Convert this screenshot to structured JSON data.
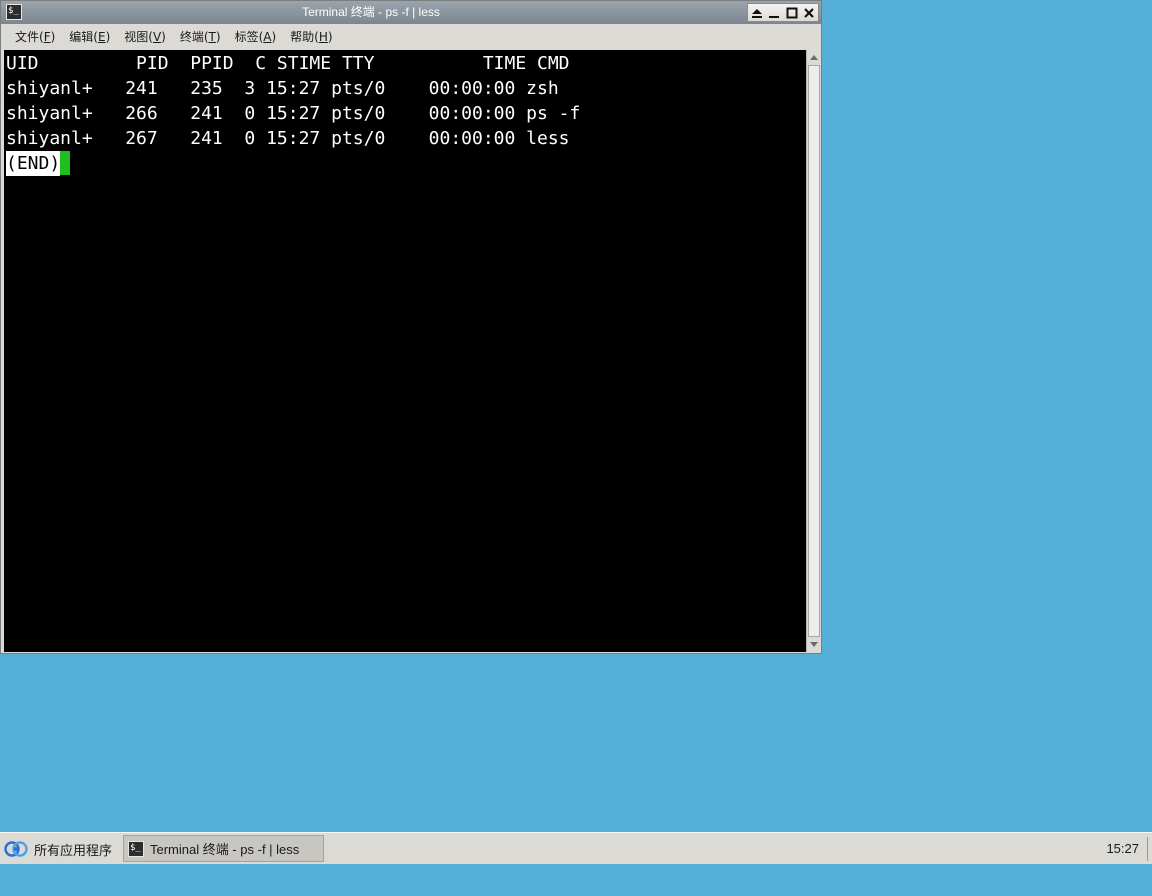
{
  "window": {
    "title": "Terminal 终端 - ps -f | less",
    "icon": "terminal-icon",
    "controls": [
      "shade-icon",
      "minimize-icon",
      "maximize-icon",
      "close-icon"
    ]
  },
  "menubar": {
    "items": [
      {
        "label": "文件(",
        "key": "F",
        "suffix": ")"
      },
      {
        "label": "编辑(",
        "key": "E",
        "suffix": ")"
      },
      {
        "label": "视图(",
        "key": "V",
        "suffix": ")"
      },
      {
        "label": "终端(",
        "key": "T",
        "suffix": ")"
      },
      {
        "label": "标签(",
        "key": "A",
        "suffix": ")"
      },
      {
        "label": "帮助(",
        "key": "H",
        "suffix": ")"
      }
    ]
  },
  "terminal": {
    "lines": [
      "UID         PID  PPID  C STIME TTY          TIME CMD",
      "shiyanl+   241   235  3 15:27 pts/0    00:00:00 zsh",
      "shiyanl+   266   241  0 15:27 pts/0    00:00:00 ps -f",
      "shiyanl+   267   241  0 15:27 pts/0    00:00:00 less"
    ],
    "pager_status": "(END)",
    "cursor_color": "#1fbf1f",
    "background": "#000000",
    "foreground": "#ffffff"
  },
  "taskbar": {
    "app_menu_label": "所有应用程序",
    "task_label": "Terminal 终端 - ps -f | less",
    "clock": "15:27"
  },
  "colors": {
    "desktop": "#55afd9",
    "chrome": "#dcdad5"
  }
}
